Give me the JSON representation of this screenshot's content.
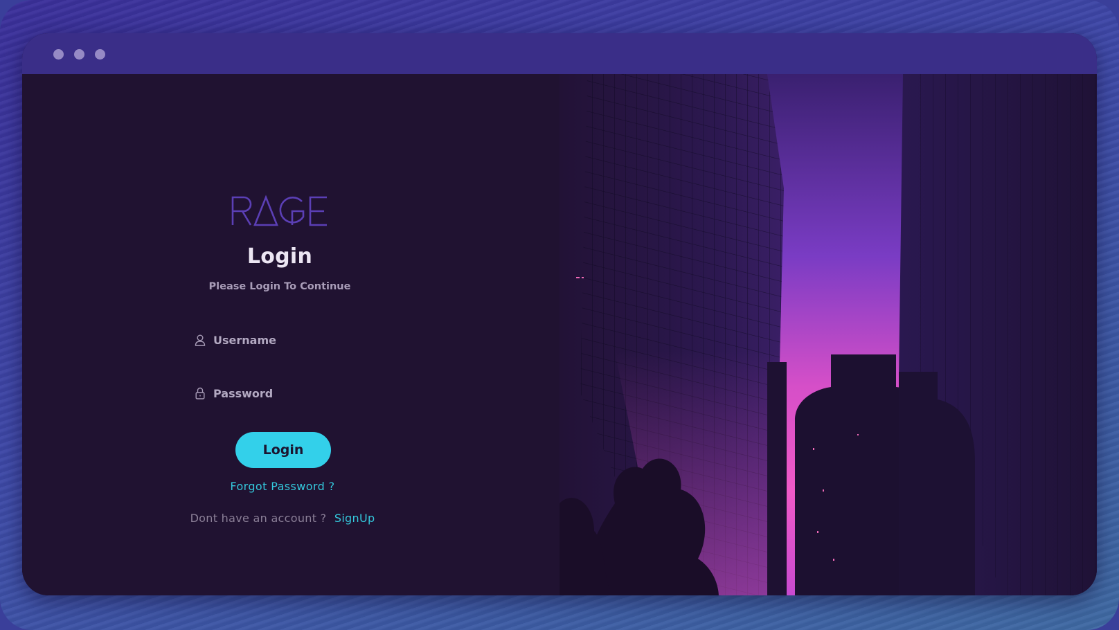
{
  "window": {
    "controls": [
      "close",
      "minimize",
      "maximize"
    ]
  },
  "brand": {
    "logo_text": "RAGE",
    "logo_color": "#5b3fb5"
  },
  "login": {
    "title": "Login",
    "subtitle": "Please Login To Continue",
    "username": {
      "placeholder": "Username",
      "value": "",
      "icon": "user-icon"
    },
    "password": {
      "placeholder": "Password",
      "value": "",
      "icon": "lock-icon"
    },
    "submit_label": "Login",
    "forgot_label": "Forgot Password ?",
    "signup_prompt": "Dont have an account ?",
    "signup_label": "SignUp"
  },
  "colors": {
    "accent": "#33d0ea",
    "background": "#201231",
    "titlebar": "#3a2e88",
    "sky_glow": "#e44fc4"
  },
  "hero_image": {
    "description_icon": "city-skyline-image"
  }
}
